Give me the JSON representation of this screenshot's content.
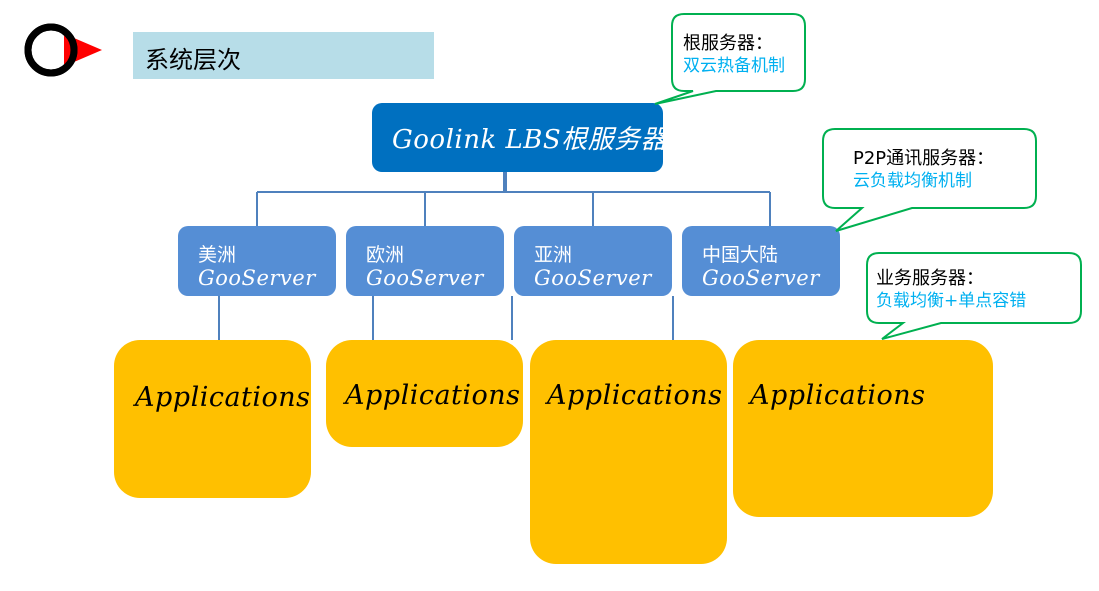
{
  "header": {
    "title": "系统层次",
    "logo_icon": "circle-arrow-logo"
  },
  "colors": {
    "root_fill": "#0070c0",
    "region_fill": "#558ed5",
    "app_fill": "#ffc000",
    "connector": "#4f81bd",
    "callout_border": "#00b050",
    "callout_subtext": "#00b0f0",
    "title_bar": "#b7dde8",
    "logo_accent": "#ff0000"
  },
  "root": {
    "label": "Goolink LBS根服务器"
  },
  "regions": [
    {
      "name": "美洲",
      "server": "GooServer"
    },
    {
      "name": "欧洲",
      "server": "GooServer"
    },
    {
      "name": "亚洲",
      "server": "GooServer"
    },
    {
      "name": "中国大陆",
      "server": "GooServer"
    }
  ],
  "applications": [
    {
      "label": "Applications"
    },
    {
      "label": "Applications"
    },
    {
      "label": "Applications"
    },
    {
      "label": "Applications"
    }
  ],
  "callouts": [
    {
      "title": "根服务器：",
      "detail": "双云热备机制"
    },
    {
      "title": "P2P通讯服务器：",
      "detail": "云负载均衡机制"
    },
    {
      "title": "业务服务器：",
      "detail": "负载均衡+单点容错"
    }
  ]
}
